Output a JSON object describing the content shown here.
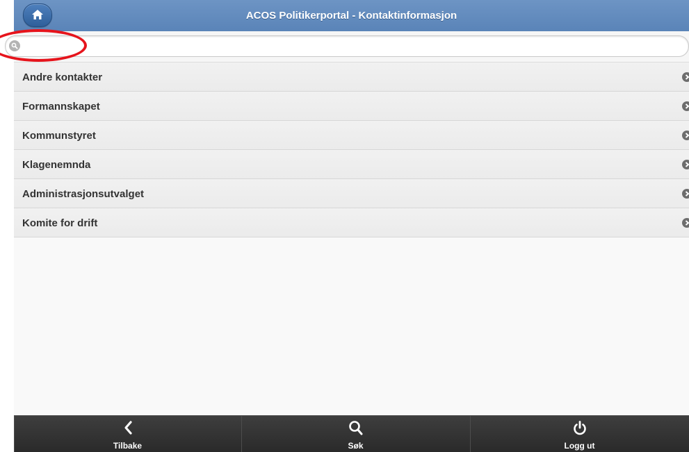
{
  "header": {
    "title": "ACOS Politikerportal - Kontaktinformasjon",
    "home_icon": "home-icon"
  },
  "search": {
    "placeholder": "",
    "value": "",
    "icon": "search-icon"
  },
  "list": {
    "items": [
      {
        "label": "Andre kontakter"
      },
      {
        "label": "Formannskapet"
      },
      {
        "label": "Kommunstyret"
      },
      {
        "label": "Klagenemnda"
      },
      {
        "label": "Administrasjonsutvalget"
      },
      {
        "label": "Komite for drift"
      }
    ]
  },
  "footer": {
    "tabs": [
      {
        "label": "Tilbake",
        "icon": "chevron-left-icon"
      },
      {
        "label": "Søk",
        "icon": "search-icon"
      },
      {
        "label": "Logg ut",
        "icon": "power-icon"
      }
    ]
  },
  "colors": {
    "header": "#5a84b8",
    "footer": "#2a2a2a",
    "annotation": "#e6141c"
  }
}
